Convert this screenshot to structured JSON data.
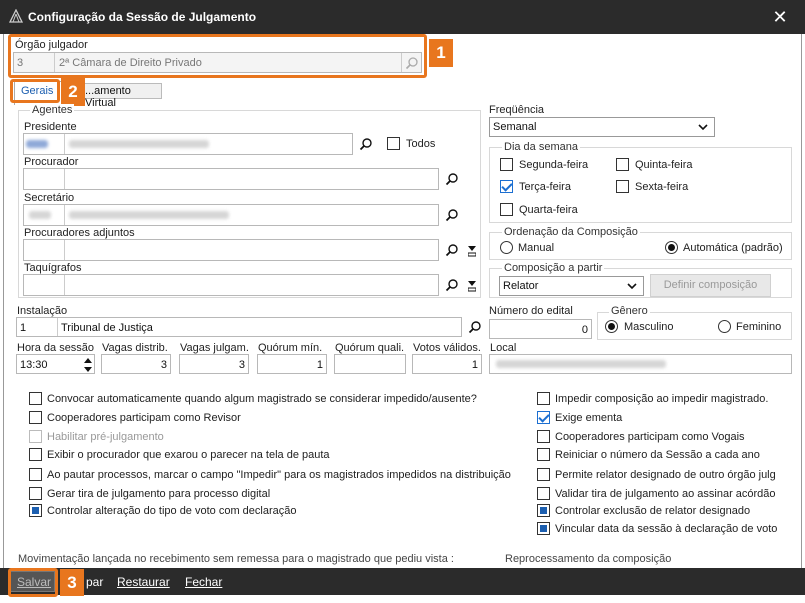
{
  "window": {
    "title": "Configuração da Sessão de Julgamento"
  },
  "orgao": {
    "label": "Órgão julgador",
    "code": "3",
    "name": "2ª Câmara de Direito Privado"
  },
  "tabs": [
    {
      "label": "Gerais"
    },
    {
      "label": "...amento Virtual"
    }
  ],
  "agentes": {
    "title": "Agentes",
    "presidente": "Presidente",
    "todos": "Todos",
    "procurador": "Procurador",
    "secretario": "Secretário",
    "procuradores_adjuntos": "Procuradores adjuntos",
    "taquigrafos": "Taquígrafos"
  },
  "frequencia": {
    "label": "Freqüência",
    "value": "Semanal"
  },
  "dia_semana": {
    "title": "Dia da semana",
    "days": [
      {
        "label": "Segunda-feira",
        "checked": false
      },
      {
        "label": "Quinta-feira",
        "checked": false
      },
      {
        "label": "Terça-feira",
        "checked": true
      },
      {
        "label": "Sexta-feira",
        "checked": false
      },
      {
        "label": "Quarta-feira",
        "checked": false
      }
    ]
  },
  "ordenacao": {
    "title": "Ordenação da Composição",
    "manual": "Manual",
    "automatica": "Automática (padrão)",
    "selected": "automatica"
  },
  "composicao": {
    "title": "Composição a partir",
    "value": "Relator",
    "button": "Definir composição"
  },
  "instalacao": {
    "label": "Instalação",
    "code": "1",
    "name": "Tribunal de Justiça"
  },
  "edital": {
    "label": "Número do edital",
    "value": "0"
  },
  "genero": {
    "title": "Gênero",
    "masculino": "Masculino",
    "feminino": "Feminino",
    "selected": "masculino"
  },
  "row_fields": [
    {
      "label": "Hora da sessão",
      "value": "13:30"
    },
    {
      "label": "Vagas distrib.",
      "value": "3"
    },
    {
      "label": "Vagas julgam.",
      "value": "3"
    },
    {
      "label": "Quórum mín.",
      "value": "1"
    },
    {
      "label": "Quórum quali.",
      "value": ""
    },
    {
      "label": "Votos válidos.",
      "value": "1"
    },
    {
      "label": "Local",
      "value": ""
    }
  ],
  "options_left": [
    {
      "label": "Convocar automaticamente quando algum magistrado se considerar impedido/ausente?",
      "state": "off"
    },
    {
      "label": "Cooperadores participam como Revisor",
      "state": "off"
    },
    {
      "label": "Habilitar pré-julgamento",
      "state": "disabled"
    },
    {
      "label": "Exibir o procurador que exarou o parecer na tela de pauta",
      "state": "off"
    },
    {
      "label": "Ao pautar processos, marcar o campo \"Impedir\" para os magistrados impedidos na distribuição",
      "state": "off"
    },
    {
      "label": "Gerar tira de julgamento para processo digital",
      "state": "off"
    },
    {
      "label": "Controlar alteração do tipo de voto com declaração",
      "state": "partial"
    }
  ],
  "options_right": [
    {
      "label": "Impedir composição ao impedir magistrado.",
      "state": "off"
    },
    {
      "label": "Exige ementa",
      "state": "checked"
    },
    {
      "label": "Cooperadores participam como Vogais",
      "state": "off"
    },
    {
      "label": "Reiniciar o número da Sessão a cada ano",
      "state": "off"
    },
    {
      "label": "Permite relator designado de outro órgão julg",
      "state": "off"
    },
    {
      "label": "Validar tira de julgamento ao assinar acórdão",
      "state": "off"
    },
    {
      "label": "Controlar exclusão de relator designado",
      "state": "partial"
    },
    {
      "label": "Vincular data da sessão à declaração de voto",
      "state": "partial"
    }
  ],
  "bottom_labels": {
    "movimentacao": "Movimentação lançada no recebimento sem remessa para o magistrado que pediu vista :",
    "reprocessamento": "Reprocessamento da composição"
  },
  "footer": {
    "salvar": "Salvar",
    "limpar": "par",
    "restaurar": "Restaurar",
    "fechar": "Fechar"
  },
  "callouts": [
    "1",
    "2",
    "3"
  ],
  "colors": {
    "titlebar": "#2b2b2b",
    "accent": "#e8761e",
    "check": "#1c6fd1"
  }
}
